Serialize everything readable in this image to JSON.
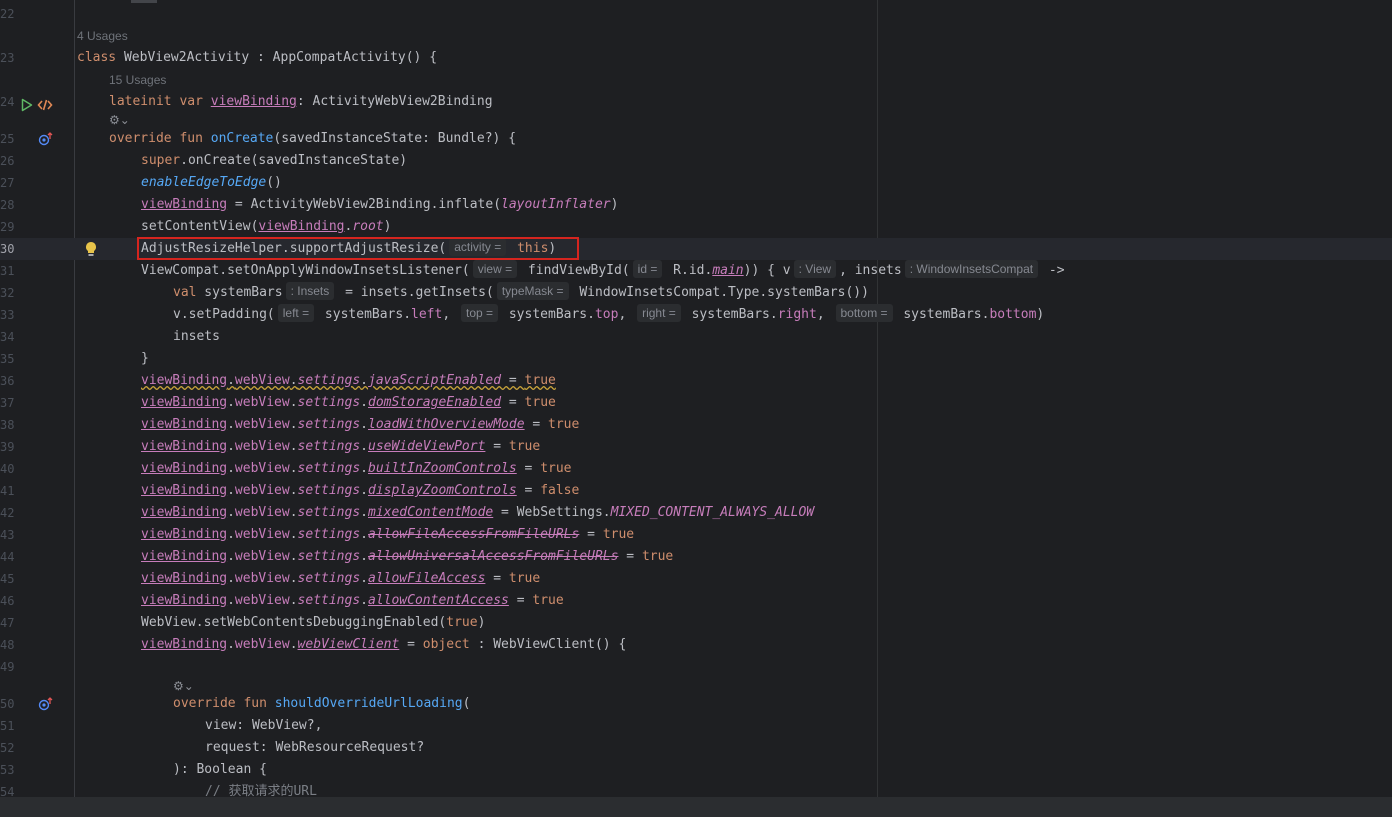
{
  "editor": {
    "file_language": "Kotlin",
    "hints": {
      "class_usages": "4 Usages",
      "property_usages": "15 Usages"
    },
    "lines": {
      "l22": "22",
      "l23": "23",
      "l24": "24",
      "l25": "25",
      "l26": "26",
      "l27": "27",
      "l28": "28",
      "l29": "29",
      "l30": "30",
      "l31": "31",
      "l32": "32",
      "l33": "33",
      "l34": "34",
      "l35": "35",
      "l36": "36",
      "l37": "37",
      "l38": "38",
      "l39": "39",
      "l40": "40",
      "l41": "41",
      "l42": "42",
      "l43": "43",
      "l44": "44",
      "l45": "45",
      "l46": "46",
      "l47": "47",
      "l48": "48",
      "l49": "49",
      "l50": "50",
      "l51": "51",
      "l52": "52",
      "l53": "53",
      "l54": "54"
    },
    "code": {
      "c23": [
        "class",
        " WebView2Activity : AppCompatActivity() {"
      ],
      "c24": [
        "lateinit",
        " ",
        "var",
        " ",
        "viewBinding",
        ": ActivityWebView2Binding"
      ],
      "c25": [
        "override",
        " ",
        "fun",
        " ",
        "onCreate",
        "(savedInstanceState: Bundle?) {"
      ],
      "c26": [
        "super",
        ".onCreate(savedInstanceState)"
      ],
      "c27": [
        "enableEdgeToEdge",
        "()"
      ],
      "c28": [
        "viewBinding",
        " = ActivityWebView2Binding.inflate(",
        "layoutInflater",
        ")"
      ],
      "c29": [
        "setContentView(",
        "viewBinding",
        ".",
        "root",
        ")"
      ],
      "c30": [
        "AdjustResizeHelper.supportAdjustResize(",
        "activity =",
        " ",
        "this",
        ")"
      ],
      "c31": [
        "ViewCompat.setOnApplyWindowInsetsListener(",
        "view =",
        " findViewById(",
        "id =",
        " R.id.",
        "main",
        ")) { v",
        ": View",
        ", insets",
        ": WindowInsetsCompat",
        " ->"
      ],
      "c32": [
        "val",
        " systemBars",
        ": Insets",
        " = insets.getInsets(",
        "typeMask =",
        " WindowInsetsCompat.Type.systemBars())"
      ],
      "c33": [
        "v.setPadding(",
        "left =",
        " systemBars.",
        "left",
        ", ",
        "top =",
        " systemBars.",
        "top",
        ", ",
        "right =",
        " systemBars.",
        "right",
        ", ",
        "bottom =",
        " systemBars.",
        "bottom",
        ")"
      ],
      "c34": "insets",
      "c35": "}",
      "c36": [
        "viewBinding",
        ".",
        "webView",
        ".",
        "settings",
        ".",
        "javaScriptEnabled",
        " = ",
        "true"
      ],
      "c37": [
        "viewBinding",
        ".",
        "webView",
        ".",
        "settings",
        ".",
        "domStorageEnabled",
        " = ",
        "true"
      ],
      "c38": [
        "viewBinding",
        ".",
        "webView",
        ".",
        "settings",
        ".",
        "loadWithOverviewMode",
        " = ",
        "true"
      ],
      "c39": [
        "viewBinding",
        ".",
        "webView",
        ".",
        "settings",
        ".",
        "useWideViewPort",
        " = ",
        "true"
      ],
      "c40": [
        "viewBinding",
        ".",
        "webView",
        ".",
        "settings",
        ".",
        "builtInZoomControls",
        " = ",
        "true"
      ],
      "c41": [
        "viewBinding",
        ".",
        "webView",
        ".",
        "settings",
        ".",
        "displayZoomControls",
        " = ",
        "false"
      ],
      "c42": [
        "viewBinding",
        ".",
        "webView",
        ".",
        "settings",
        ".",
        "mixedContentMode",
        " = WebSettings.",
        "MIXED_CONTENT_ALWAYS_ALLOW"
      ],
      "c43": [
        "viewBinding",
        ".",
        "webView",
        ".",
        "settings",
        ".",
        "allowFileAccessFromFileURLs",
        " = ",
        "true"
      ],
      "c44": [
        "viewBinding",
        ".",
        "webView",
        ".",
        "settings",
        ".",
        "allowUniversalAccessFromFileURLs",
        " = ",
        "true"
      ],
      "c45": [
        "viewBinding",
        ".",
        "webView",
        ".",
        "settings",
        ".",
        "allowFileAccess",
        " = ",
        "true"
      ],
      "c46": [
        "viewBinding",
        ".",
        "webView",
        ".",
        "settings",
        ".",
        "allowContentAccess",
        " = ",
        "true"
      ],
      "c47": [
        "WebView.setWebContentsDebuggingEnabled(",
        "true",
        ")"
      ],
      "c48": [
        "viewBinding",
        ".",
        "webView",
        ".",
        "webViewClient",
        " = ",
        "object",
        " : WebViewClient() {"
      ],
      "c50": [
        "override",
        " ",
        "fun",
        " ",
        "shouldOverrideUrlLoading",
        "("
      ],
      "c51": "view: WebView?,",
      "c52": "request: WebResourceRequest?",
      "c53": "): Boolean {",
      "c54": "// 获取请求的URL"
    }
  },
  "icons": {
    "run": "run-gutter-icon",
    "code": "code-gutter-icon",
    "override": "override-gutter-icon",
    "bulb": "intention-bulb-icon",
    "ai_hint": "ai-sparkle-icon"
  },
  "colors": {
    "background": "#1e1f22",
    "keyword": "#cf8e6d",
    "function": "#56a8f5",
    "property": "#c77dbb",
    "highlight_box": "#d5251f",
    "bulb": "#e8c44a"
  }
}
